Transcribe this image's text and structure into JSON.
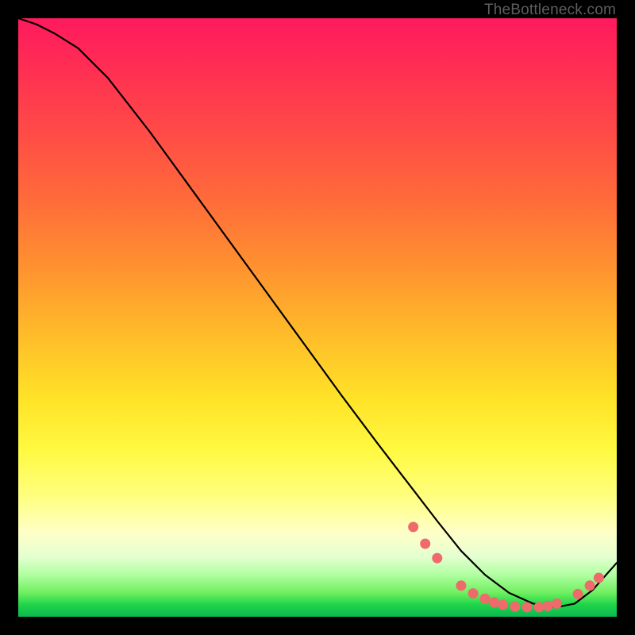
{
  "credit": "TheBottleneck.com",
  "chart_data": {
    "type": "line",
    "title": "",
    "xlabel": "",
    "ylabel": "",
    "xlim": [
      0,
      100
    ],
    "ylim": [
      0,
      100
    ],
    "series": [
      {
        "name": "curve",
        "x": [
          0,
          3,
          6,
          10,
          15,
          22,
          30,
          38,
          46,
          54,
          60,
          65,
          70,
          74,
          78,
          82,
          86,
          90,
          93,
          96,
          100
        ],
        "y": [
          100,
          99,
          97.5,
          95,
          90,
          81,
          70,
          59,
          48,
          37,
          29,
          22.5,
          16,
          11,
          7,
          4,
          2.2,
          1.6,
          2.2,
          4.5,
          9
        ]
      }
    ],
    "markers": {
      "name": "dots",
      "color": "#ef6b6b",
      "points": [
        {
          "x": 66,
          "y": 15.0
        },
        {
          "x": 68,
          "y": 12.2
        },
        {
          "x": 70,
          "y": 9.8
        },
        {
          "x": 74,
          "y": 5.2
        },
        {
          "x": 76,
          "y": 3.9
        },
        {
          "x": 78,
          "y": 3.0
        },
        {
          "x": 79.5,
          "y": 2.4
        },
        {
          "x": 81,
          "y": 2.0
        },
        {
          "x": 83,
          "y": 1.7
        },
        {
          "x": 85,
          "y": 1.6
        },
        {
          "x": 87,
          "y": 1.6
        },
        {
          "x": 88.5,
          "y": 1.8
        },
        {
          "x": 90,
          "y": 2.2
        },
        {
          "x": 93.5,
          "y": 3.8
        },
        {
          "x": 95.5,
          "y": 5.2
        },
        {
          "x": 97,
          "y": 6.5
        }
      ]
    }
  }
}
